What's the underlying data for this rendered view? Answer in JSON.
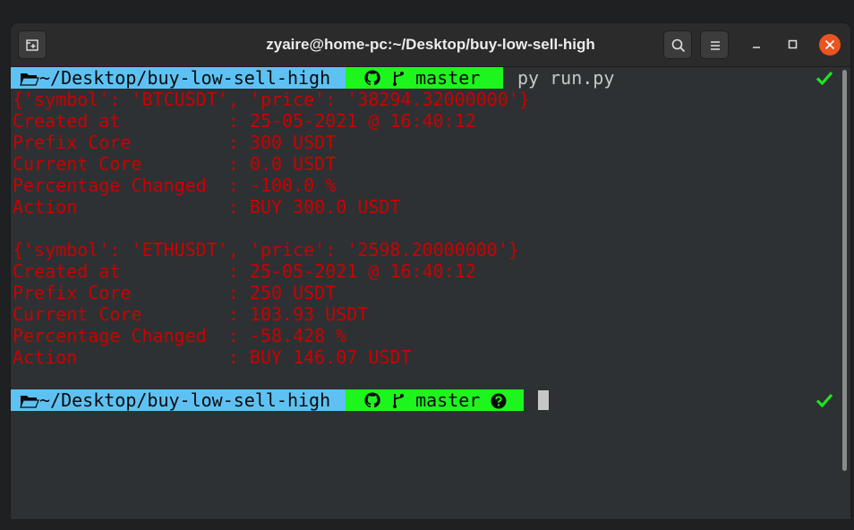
{
  "window": {
    "title": "zyaire@home-pc:~/Desktop/buy-low-sell-high"
  },
  "prompts": [
    {
      "path": "~/Desktop/buy-low-sell-high",
      "branch": "master",
      "command": "py run.py",
      "status_icon": "check-icon"
    },
    {
      "path": "~/Desktop/buy-low-sell-high",
      "branch": "master",
      "command": "",
      "status_icon": "check-icon"
    }
  ],
  "output": [
    {
      "header": "{'symbol': 'BTCUSDT', 'price': '38294.32000000'}",
      "rows": [
        {
          "label": "Created at          ",
          "value": ": 25-05-2021 @ 16:40:12"
        },
        {
          "label": "Prefix Core         ",
          "value": ": 300 USDT"
        },
        {
          "label": "Current Core        ",
          "value": ": 0.0 USDT"
        },
        {
          "label": "Percentage Changed  ",
          "value": ": -100.0 %"
        },
        {
          "label": "Action              ",
          "value": ": BUY 300.0 USDT"
        }
      ]
    },
    {
      "header": "{'symbol': 'ETHUSDT', 'price': '2598.20000000'}",
      "rows": [
        {
          "label": "Created at          ",
          "value": ": 25-05-2021 @ 16:40:12"
        },
        {
          "label": "Prefix Core         ",
          "value": ": 250 USDT"
        },
        {
          "label": "Current Core        ",
          "value": ": 103.93 USDT"
        },
        {
          "label": "Percentage Changed  ",
          "value": ": -58.428 %"
        },
        {
          "label": "Action              ",
          "value": ": BUY 146.07 USDT"
        }
      ]
    }
  ],
  "colors": {
    "path_bg": "#5ec1f3",
    "git_bg": "#1df61d",
    "output_text": "#cc0000",
    "check": "#1ee51e"
  },
  "icons": [
    "new-tab-icon",
    "search-icon",
    "hamburger-menu-icon",
    "minimize-icon",
    "maximize-icon",
    "close-icon",
    "folder-icon",
    "github-icon",
    "git-branch-icon",
    "question-circle-icon",
    "check-icon"
  ]
}
